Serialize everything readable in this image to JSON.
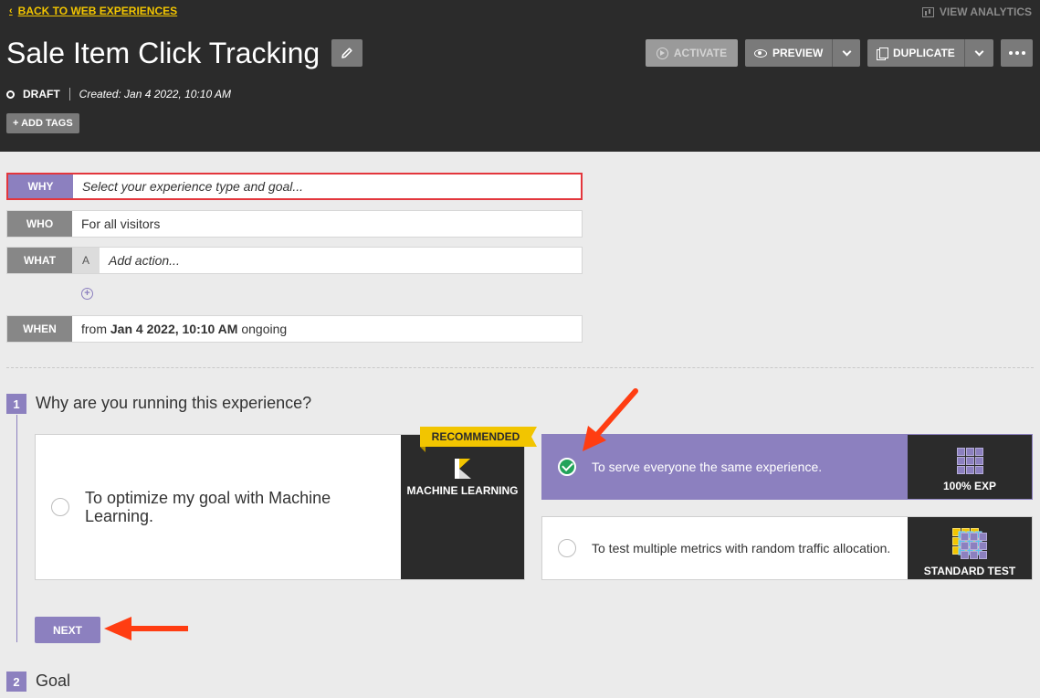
{
  "header": {
    "back_link": "BACK TO WEB EXPERIENCES",
    "view_analytics": "VIEW ANALYTICS",
    "title": "Sale Item Click Tracking",
    "status": "DRAFT",
    "created": "Created: Jan 4 2022, 10:10 AM",
    "add_tags": "+ ADD TAGS",
    "buttons": {
      "activate": "ACTIVATE",
      "preview": "PREVIEW",
      "duplicate": "DUPLICATE"
    }
  },
  "summary": {
    "why": {
      "tag": "WHY",
      "value": "Select your experience type and goal..."
    },
    "who": {
      "tag": "WHO",
      "value": "For all visitors"
    },
    "what": {
      "tag": "WHAT",
      "variant": "A",
      "value": "Add action..."
    },
    "when": {
      "tag": "WHEN",
      "prefix": "from",
      "date": "Jan 4 2022, 10:10 AM",
      "suffix": "ongoing"
    }
  },
  "step1": {
    "number": "1",
    "title": "Why are you running this experience?",
    "options": [
      {
        "text": "To optimize my goal with Machine Learning.",
        "side_label": "MACHINE LEARNING",
        "badge": "RECOMMENDED",
        "selected": false
      },
      {
        "text": "To serve everyone the same experience.",
        "side_label": "100% EXP",
        "selected": true
      },
      {
        "text": "To test multiple metrics with random traffic allocation.",
        "side_label": "STANDARD TEST",
        "selected": false
      }
    ],
    "next": "NEXT"
  },
  "step2": {
    "number": "2",
    "title": "Goal"
  },
  "colors": {
    "header_bg": "#2b2b2b",
    "accent_purple": "#8c80bf",
    "link_yellow": "#f2c500",
    "highlight_red": "#e3363c",
    "annotation_arrow": "#ff3d12",
    "check_green": "#22a35a"
  }
}
